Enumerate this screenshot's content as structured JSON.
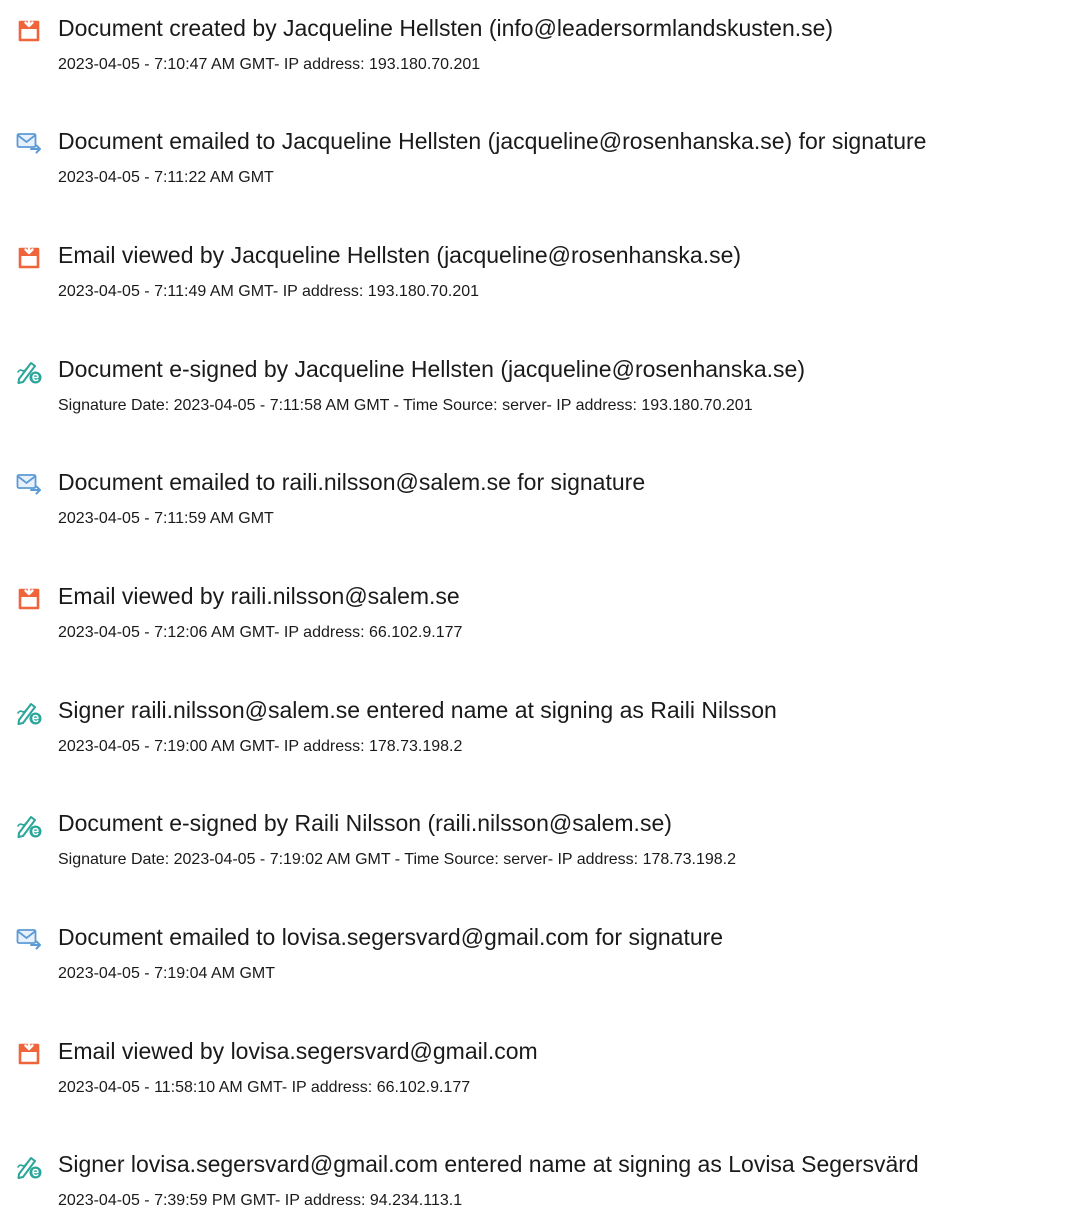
{
  "colors": {
    "doc_icon": "#f0643c",
    "email_icon": "#5b9bd5",
    "sign_icon": "#2aa59a",
    "text": "#1a1a1a"
  },
  "events": [
    {
      "icon": "document-icon",
      "title": "Document created by Jacqueline Hellsten (info@leadersormlandskusten.se)",
      "detail": "2023-04-05 - 7:10:47 AM GMT- IP address: 193.180.70.201"
    },
    {
      "icon": "email-sent-icon",
      "title": "Document emailed to Jacqueline Hellsten (jacqueline@rosenhanska.se) for signature",
      "detail": "2023-04-05 - 7:11:22 AM GMT"
    },
    {
      "icon": "document-icon",
      "title": "Email viewed by Jacqueline Hellsten (jacqueline@rosenhanska.se)",
      "detail": "2023-04-05 - 7:11:49 AM GMT- IP address: 193.180.70.201"
    },
    {
      "icon": "e-sign-icon",
      "title": "Document e-signed by Jacqueline Hellsten (jacqueline@rosenhanska.se)",
      "detail": "Signature Date: 2023-04-05 - 7:11:58 AM GMT - Time Source: server- IP address: 193.180.70.201"
    },
    {
      "icon": "email-sent-icon",
      "title": "Document emailed to raili.nilsson@salem.se for signature",
      "detail": "2023-04-05 - 7:11:59 AM GMT"
    },
    {
      "icon": "document-icon",
      "title": "Email viewed by raili.nilsson@salem.se",
      "detail": "2023-04-05 - 7:12:06 AM GMT- IP address: 66.102.9.177"
    },
    {
      "icon": "e-sign-icon",
      "title": "Signer raili.nilsson@salem.se entered name at signing as Raili Nilsson",
      "detail": "2023-04-05 - 7:19:00 AM GMT- IP address: 178.73.198.2"
    },
    {
      "icon": "e-sign-icon",
      "title": "Document e-signed by Raili Nilsson (raili.nilsson@salem.se)",
      "detail": "Signature Date: 2023-04-05 - 7:19:02 AM GMT - Time Source: server- IP address: 178.73.198.2"
    },
    {
      "icon": "email-sent-icon",
      "title": "Document emailed to lovisa.segersvard@gmail.com for signature",
      "detail": "2023-04-05 - 7:19:04 AM GMT"
    },
    {
      "icon": "document-icon",
      "title": "Email viewed by lovisa.segersvard@gmail.com",
      "detail": "2023-04-05 - 11:58:10 AM GMT- IP address: 66.102.9.177"
    },
    {
      "icon": "e-sign-icon",
      "title": "Signer lovisa.segersvard@gmail.com entered name at signing as Lovisa Segersvärd",
      "detail": "2023-04-05 - 7:39:59 PM GMT- IP address: 94.234.113.1"
    }
  ]
}
